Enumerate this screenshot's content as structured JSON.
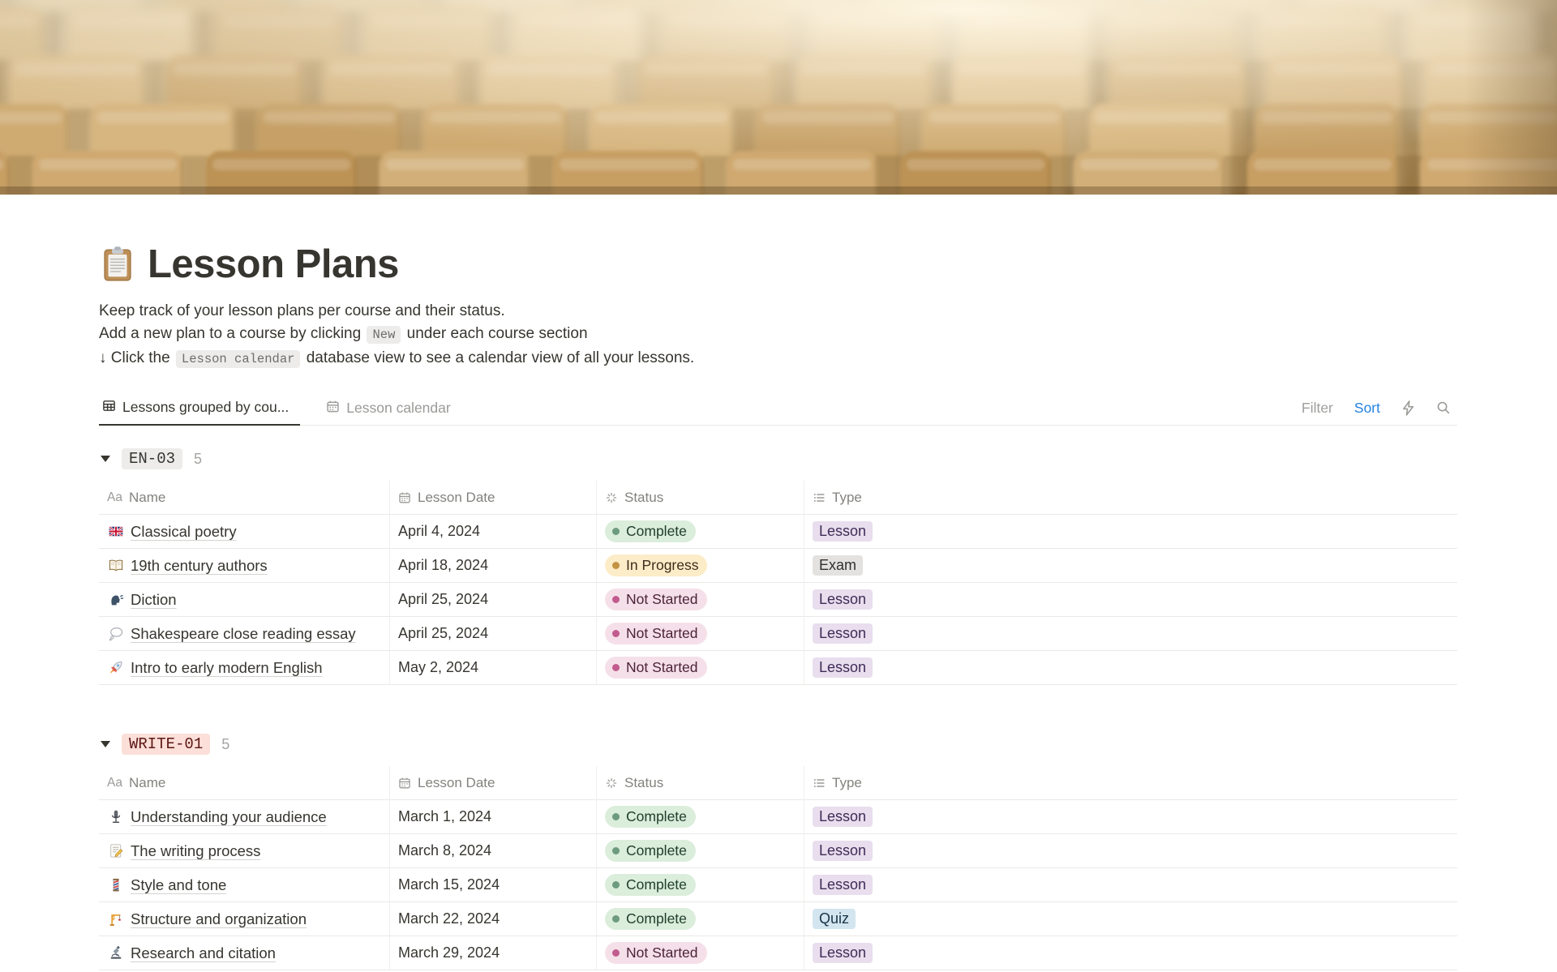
{
  "page": {
    "icon": "clipboard",
    "title": "Lesson Plans",
    "description": {
      "line1": "Keep track of your lesson plans per course and their status.",
      "line2_before": "Add a new plan to a course by clicking",
      "line2_code": "New",
      "line2_after": "under each course section",
      "line3_before": "↓ Click the",
      "line3_code": "Lesson calendar",
      "line3_after": "database view to see a calendar view of all your lessons."
    }
  },
  "tabs": [
    {
      "label": "Lessons grouped by cou...",
      "icon": "table-icon",
      "active": true
    },
    {
      "label": "Lesson calendar",
      "icon": "calendar-icon",
      "active": false
    }
  ],
  "toolbar": {
    "filter_label": "Filter",
    "sort_label": "Sort",
    "icons": [
      "lightning-icon",
      "search-icon"
    ]
  },
  "table": {
    "columns": [
      {
        "label": "Name",
        "icon": "aa-icon"
      },
      {
        "label": "Lesson Date",
        "icon": "calendar-icon"
      },
      {
        "label": "Status",
        "icon": "status-burst-icon"
      },
      {
        "label": "Type",
        "icon": "list-icon"
      }
    ]
  },
  "groups": [
    {
      "id": "EN-03",
      "count": "5",
      "badge": {
        "bg": "#EDECEA",
        "text": "#37352F"
      },
      "rows": [
        {
          "icon": "uk-flag",
          "name": "Classical poetry",
          "date": "April 4, 2024",
          "status": "Complete",
          "status_color": "green",
          "type": "Lesson",
          "type_color": "purple"
        },
        {
          "icon": "open-book",
          "name": "19th century authors",
          "date": "April 18, 2024",
          "status": "In Progress",
          "status_color": "yellow",
          "type": "Exam",
          "type_color": "gray"
        },
        {
          "icon": "speaking-head",
          "name": "Diction",
          "date": "April 25, 2024",
          "status": "Not Started",
          "status_color": "pink",
          "type": "Lesson",
          "type_color": "purple"
        },
        {
          "icon": "thought-balloon",
          "name": "Shakespeare close reading essay",
          "date": "April 25, 2024",
          "status": "Not Started",
          "status_color": "pink",
          "type": "Lesson",
          "type_color": "purple"
        },
        {
          "icon": "rocket",
          "name": "Intro to early modern English",
          "date": "May 2, 2024",
          "status": "Not Started",
          "status_color": "pink",
          "type": "Lesson",
          "type_color": "purple"
        }
      ]
    },
    {
      "id": "WRITE-01",
      "count": "5",
      "badge": {
        "bg": "#FBDFD8",
        "text": "#5D1715"
      },
      "rows": [
        {
          "icon": "microphone",
          "name": "Understanding your audience",
          "date": "March 1, 2024",
          "status": "Complete",
          "status_color": "green",
          "type": "Lesson",
          "type_color": "purple"
        },
        {
          "icon": "memo",
          "name": "The writing process",
          "date": "March 8, 2024",
          "status": "Complete",
          "status_color": "green",
          "type": "Lesson",
          "type_color": "purple"
        },
        {
          "icon": "thread",
          "name": "Style and tone",
          "date": "March 15, 2024",
          "status": "Complete",
          "status_color": "green",
          "type": "Lesson",
          "type_color": "purple"
        },
        {
          "icon": "crane",
          "name": "Structure and organization",
          "date": "March 22, 2024",
          "status": "Complete",
          "status_color": "green",
          "type": "Quiz",
          "type_color": "blue"
        },
        {
          "icon": "microscope",
          "name": "Research and citation",
          "date": "March 29, 2024",
          "status": "Not Started",
          "status_color": "pink",
          "type": "Lesson",
          "type_color": "purple"
        }
      ]
    }
  ],
  "colors": {
    "status": {
      "green": {
        "bg": "#DBEDDB",
        "dot": "#6C9B7D",
        "text": "#1F3D2B"
      },
      "yellow": {
        "bg": "#FDECC8",
        "dot": "#C29343",
        "text": "#402C1B"
      },
      "pink": {
        "bg": "#F5E0E9",
        "dot": "#C25B8E",
        "text": "#4C2337"
      }
    },
    "type": {
      "purple": {
        "bg": "#E8DEEE",
        "text": "#3F2C56"
      },
      "gray": {
        "bg": "#E3E2E0",
        "text": "#32302C"
      },
      "blue": {
        "bg": "#D3E5EF",
        "text": "#183347"
      }
    },
    "accent_blue": "#2383E2"
  }
}
